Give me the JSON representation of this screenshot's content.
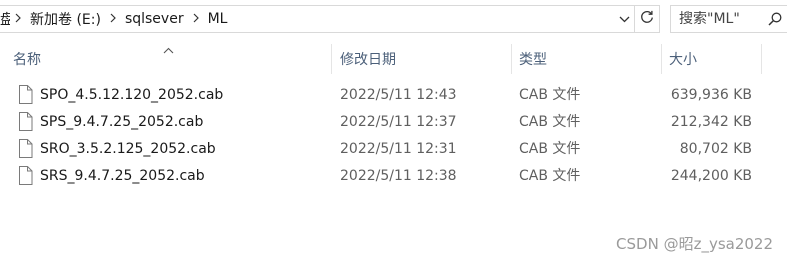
{
  "address_bar": {
    "cut_off_segment": "盘",
    "breadcrumbs": [
      {
        "label": "新加卷 (E:)"
      },
      {
        "label": "sqlsever"
      },
      {
        "label": "ML"
      }
    ]
  },
  "search": {
    "placeholder": "搜索\"ML\""
  },
  "columns": {
    "name": "名称",
    "date_modified": "修改日期",
    "type": "类型",
    "size": "大小"
  },
  "files": [
    {
      "name": "SPO_4.5.12.120_2052.cab",
      "date_modified": "2022/5/11 12:43",
      "type": "CAB 文件",
      "size": "639,936 KB"
    },
    {
      "name": "SPS_9.4.7.25_2052.cab",
      "date_modified": "2022/5/11 12:37",
      "type": "CAB 文件",
      "size": "212,342 KB"
    },
    {
      "name": "SRO_3.5.2.125_2052.cab",
      "date_modified": "2022/5/11 12:31",
      "type": "CAB 文件",
      "size": "80,702 KB"
    },
    {
      "name": "SRS_9.4.7.25_2052.cab",
      "date_modified": "2022/5/11 12:38",
      "type": "CAB 文件",
      "size": "244,200 KB"
    }
  ],
  "watermark": "CSDN @昭z_ysa2022"
}
